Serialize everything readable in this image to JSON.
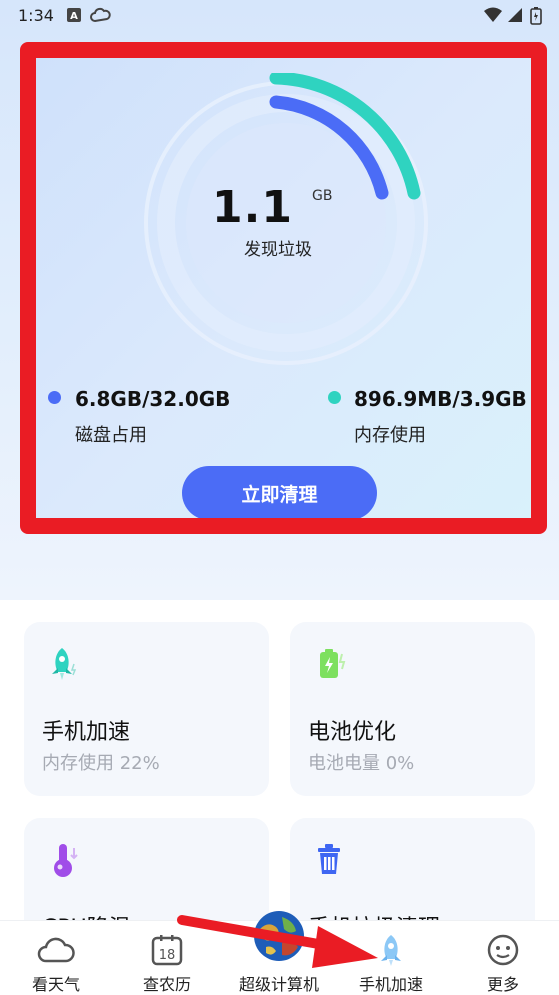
{
  "status_bar": {
    "time": "1:34"
  },
  "hero": {
    "junk_value": "1.1",
    "junk_unit": "GB",
    "junk_label": "发现垃圾",
    "disk": {
      "value": "6.8GB/32.0GB",
      "label": "磁盘占用",
      "color": "#4b6cf6"
    },
    "memory": {
      "value": "896.9MB/3.9GB",
      "label": "内存使用",
      "color": "#2fd3c0"
    },
    "clean_button_label": "立即清理"
  },
  "features": [
    {
      "title": "手机加速",
      "subtitle": "内存使用 22%",
      "icon": "rocket-icon"
    },
    {
      "title": "电池优化",
      "subtitle": "电池电量 0%",
      "icon": "battery-icon"
    },
    {
      "title": "CPU降温",
      "subtitle": "",
      "icon": "thermometer-icon"
    },
    {
      "title": "手机垃圾清理",
      "subtitle": "",
      "icon": "trash-icon"
    }
  ],
  "bottom_nav": [
    {
      "label": "看天气",
      "icon": "weather-icon"
    },
    {
      "label": "查农历",
      "icon": "calendar-icon",
      "badge": "18"
    },
    {
      "label": "超级计算机",
      "icon": "globe-icon"
    },
    {
      "label": "手机加速",
      "icon": "rocket-icon"
    },
    {
      "label": "更多",
      "icon": "smiley-icon"
    }
  ],
  "colors": {
    "accent": "#4b6cf6",
    "teal": "#2fd3c0",
    "highlight_border": "#ea1c24"
  }
}
